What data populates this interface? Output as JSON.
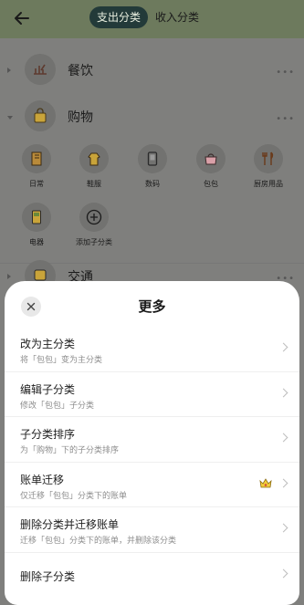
{
  "header": {
    "back_icon": "arrow-left-icon",
    "tabs": [
      {
        "label": "支出分类",
        "active": true
      },
      {
        "label": "收入分类",
        "active": false
      }
    ]
  },
  "categories": [
    {
      "label": "餐饮",
      "icon": "dining-icon",
      "expanded": false
    },
    {
      "label": "购物",
      "icon": "shopping-bag-icon",
      "expanded": true
    },
    {
      "label": "交通",
      "icon": "bus-icon",
      "expanded": false
    }
  ],
  "subcategories": [
    {
      "label": "日常",
      "icon": "notebook-icon"
    },
    {
      "label": "鞋服",
      "icon": "clothes-icon"
    },
    {
      "label": "数码",
      "icon": "phone-icon"
    },
    {
      "label": "包包",
      "icon": "handbag-icon"
    },
    {
      "label": "厨房用品",
      "icon": "utensils-icon"
    },
    {
      "label": "电器",
      "icon": "appliance-icon"
    },
    {
      "label": "添加子分类",
      "icon": "add-circle-icon"
    }
  ],
  "sheet": {
    "title": "更多",
    "close_icon": "close-icon",
    "items": [
      {
        "title": "改为主分类",
        "subtitle": "将「包包」变为主分类"
      },
      {
        "title": "编辑子分类",
        "subtitle": "修改「包包」子分类"
      },
      {
        "title": "子分类排序",
        "subtitle": "为「购物」下的子分类排序"
      },
      {
        "title": "账单迁移",
        "subtitle": "仅迁移「包包」分类下的账单",
        "badge": "crown-icon"
      },
      {
        "title": "删除分类并迁移账单",
        "subtitle": "迁移「包包」分类下的账单，并删除该分类"
      },
      {
        "title": "删除子分类",
        "subtitle": ""
      }
    ]
  },
  "colors": {
    "overlay": "#7f7f7d",
    "header": "#6d7a5d",
    "active_tab": "#233a39",
    "crown": "#e0b62a"
  }
}
